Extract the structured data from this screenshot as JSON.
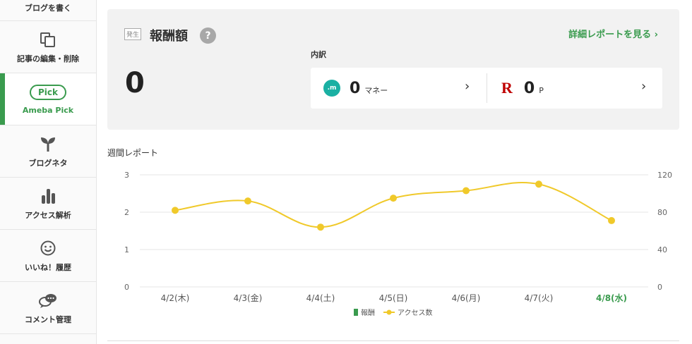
{
  "sidebar": {
    "items": [
      {
        "label": "ブログを書く",
        "icon": "pen-icon"
      },
      {
        "label": "記事の編集・削除",
        "icon": "documents-icon"
      },
      {
        "label": "Ameba Pick",
        "icon": "pick-icon",
        "pill": "Pick",
        "active": true
      },
      {
        "label": "ブログネタ",
        "icon": "sprout-icon"
      },
      {
        "label": "アクセス解析",
        "icon": "bar-chart-icon"
      },
      {
        "label": "いいね！履歴",
        "icon": "smiley-icon"
      },
      {
        "label": "コメント管理",
        "icon": "speech-bubbles-icon"
      }
    ]
  },
  "reward_card": {
    "badge": "発生",
    "title": "報酬額",
    "help": "?",
    "detail_link": "詳細レポートを見る ›",
    "amount": "0",
    "breakdown_label": "内訳",
    "items": [
      {
        "value": "0",
        "unit": "マネー",
        "icon_text": ".m",
        "chevron": "›"
      },
      {
        "value": "0",
        "unit": "P",
        "icon_text": "R",
        "chevron": "›"
      }
    ]
  },
  "weekly": {
    "title": "週間レポート"
  },
  "colors": {
    "accent": "#3a9b4e",
    "line": "#f0c92a",
    "rakuten": "#bf0000",
    "money": "#1ab0a3"
  },
  "chart_data": {
    "type": "line",
    "categories": [
      "4/2(木)",
      "4/3(金)",
      "4/4(土)",
      "4/5(日)",
      "4/6(月)",
      "4/7(火)",
      "4/8(水)"
    ],
    "highlight_category": "4/8(水)",
    "y_left": {
      "ticks": [
        "0",
        "1",
        "2",
        "3"
      ],
      "range": [
        0,
        3
      ]
    },
    "y_right": {
      "ticks": [
        "0",
        "40",
        "80",
        "120"
      ],
      "range": [
        0,
        120
      ]
    },
    "series": [
      {
        "name": "報酬",
        "type": "bar",
        "axis": "left",
        "color": "#3a9b4e",
        "values": [
          0,
          0,
          0,
          0,
          0,
          0,
          0
        ]
      },
      {
        "name": "アクセス数",
        "type": "line",
        "axis": "right",
        "color": "#f0c92a",
        "values": [
          82,
          92,
          64,
          95,
          103,
          110,
          71
        ]
      }
    ],
    "legend": "bottom"
  }
}
